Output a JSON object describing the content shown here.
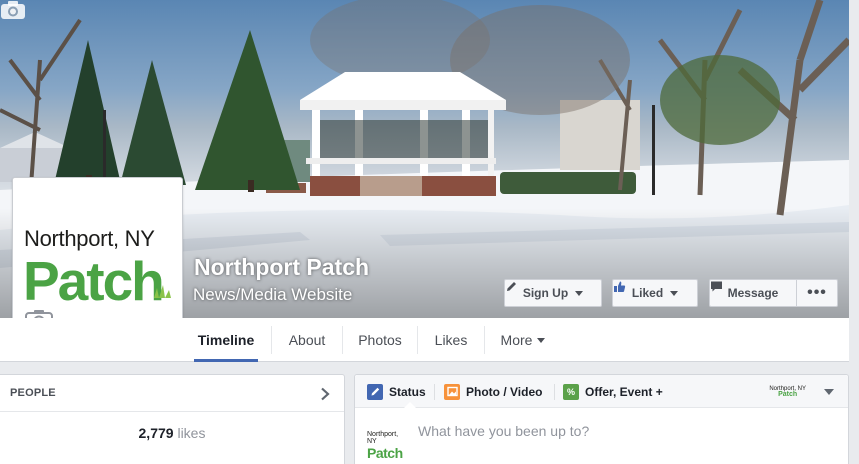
{
  "page": {
    "name": "Northport Patch",
    "category": "News/Media Website"
  },
  "profile": {
    "place": "Northport, NY",
    "brand": "Patch",
    "brand_color": "#4ba345"
  },
  "actions": {
    "signup": "Sign Up",
    "liked": "Liked",
    "message": "Message",
    "more": "•••"
  },
  "nav": {
    "tabs": [
      "Timeline",
      "About",
      "Photos",
      "Likes",
      "More"
    ],
    "active": "Timeline",
    "accent": "#4267b2"
  },
  "people": {
    "title": "PEOPLE",
    "likes_count": "2,779",
    "likes_word": "likes"
  },
  "composer": {
    "tabs": [
      "Status",
      "Photo / Video",
      "Offer, Event +"
    ],
    "placeholder": "What have you been up to?",
    "mini_place": "Northport, NY",
    "mini_brand": "Patch",
    "avatar_place": "Northport, NY",
    "avatar_brand": "Patch"
  },
  "icons": {
    "cover_camera": "camera-icon",
    "profile_camera": "camera-icon",
    "signup": "pencil-icon",
    "liked": "thumbs-up-icon",
    "message": "speech-bubble-icon",
    "people_more": "chevron-right-icon",
    "status": "pencil-icon",
    "photo": "photo-icon",
    "offer": "offer-tag-icon"
  }
}
